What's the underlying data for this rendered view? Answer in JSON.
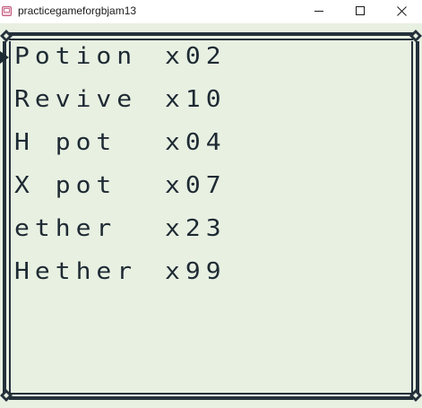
{
  "window": {
    "title": "practicegameforgbjam13",
    "icon": "gameboy-app-icon",
    "controls": {
      "minimize_icon": "minimize-icon",
      "maximize_icon": "maximize-icon",
      "close_icon": "close-icon"
    }
  },
  "colors": {
    "background": "#e8f0e2",
    "ink": "#1e2a33",
    "frame": "#24313b"
  },
  "inventory": {
    "selected_index": 0,
    "cursor_icon": "selection-arrow-icon",
    "items": [
      {
        "name": "Potion",
        "qty": "x02"
      },
      {
        "name": "Revive",
        "qty": "x10"
      },
      {
        "name": "H pot",
        "qty": "x04"
      },
      {
        "name": "X pot",
        "qty": "x07"
      },
      {
        "name": "ether",
        "qty": "x23"
      },
      {
        "name": "Hether",
        "qty": "x99"
      }
    ]
  }
}
